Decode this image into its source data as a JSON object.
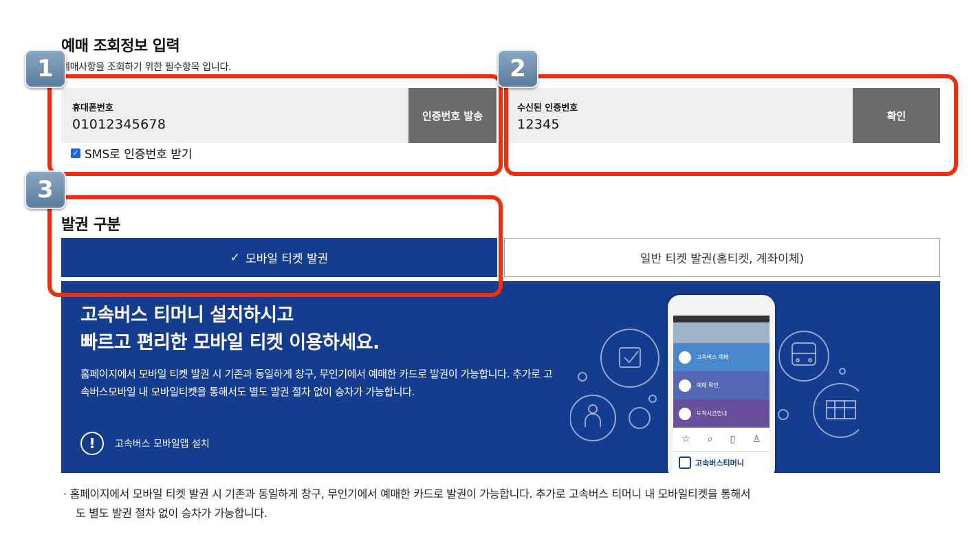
{
  "section": {
    "title": "예매 조회정보 입력",
    "subtitle": "예매사항을 조회하기 위한 필수항목 입니다."
  },
  "phone": {
    "label": "휴대폰번호",
    "value": "01012345678",
    "send_button": "인증번호 발송"
  },
  "auth": {
    "label": "수신된 인증번호",
    "value": "12345",
    "confirm_button": "확인"
  },
  "sms": {
    "label": "SMS로 인증번호 받기",
    "checked": true
  },
  "badges": [
    "1",
    "2",
    "3"
  ],
  "issue": {
    "title": "발권 구분",
    "tab_mobile": "모바일 티켓 발권",
    "tab_mobile_check": "✓",
    "tab_general": "일반 티켓 발권(홈티켓, 계좌이체)"
  },
  "promo": {
    "headline1": "고속버스 티머니 설치하시고",
    "headline2": "빠르고 편리한 모바일 티켓 이용하세요.",
    "body": "홈페이지에서 모바일 티켓 발권 시 기존과 동일하게 창구, 무인기에서 예매한 카드로 발권이 가능합니다. 추가로 고속버스모바일 내 모바일티켓을 통해서도 별도 발권 절차 없이 승차가 가능합니다.",
    "install_link": "고속버스 모바일앱 설치",
    "phone_menu": [
      "고속버스 예매",
      "예매 확인",
      "도착시간안내"
    ],
    "phone_app_name": "고속버스티머니"
  },
  "note": {
    "line1": "· 홈페이지에서 모바일 티켓 발권 시 기존과 동일하게 창구, 무인기에서 예매한 카드로 발권이 가능합니다. 추가로 고속버스 티머니 내 모바일티켓을 통해서",
    "line2": "도 별도 발권 절차 없이 승차가 가능합니다."
  },
  "colors": {
    "navy": "#153d8f",
    "highlight": "#ef2d0f",
    "button_gray": "#6b6b6b"
  }
}
